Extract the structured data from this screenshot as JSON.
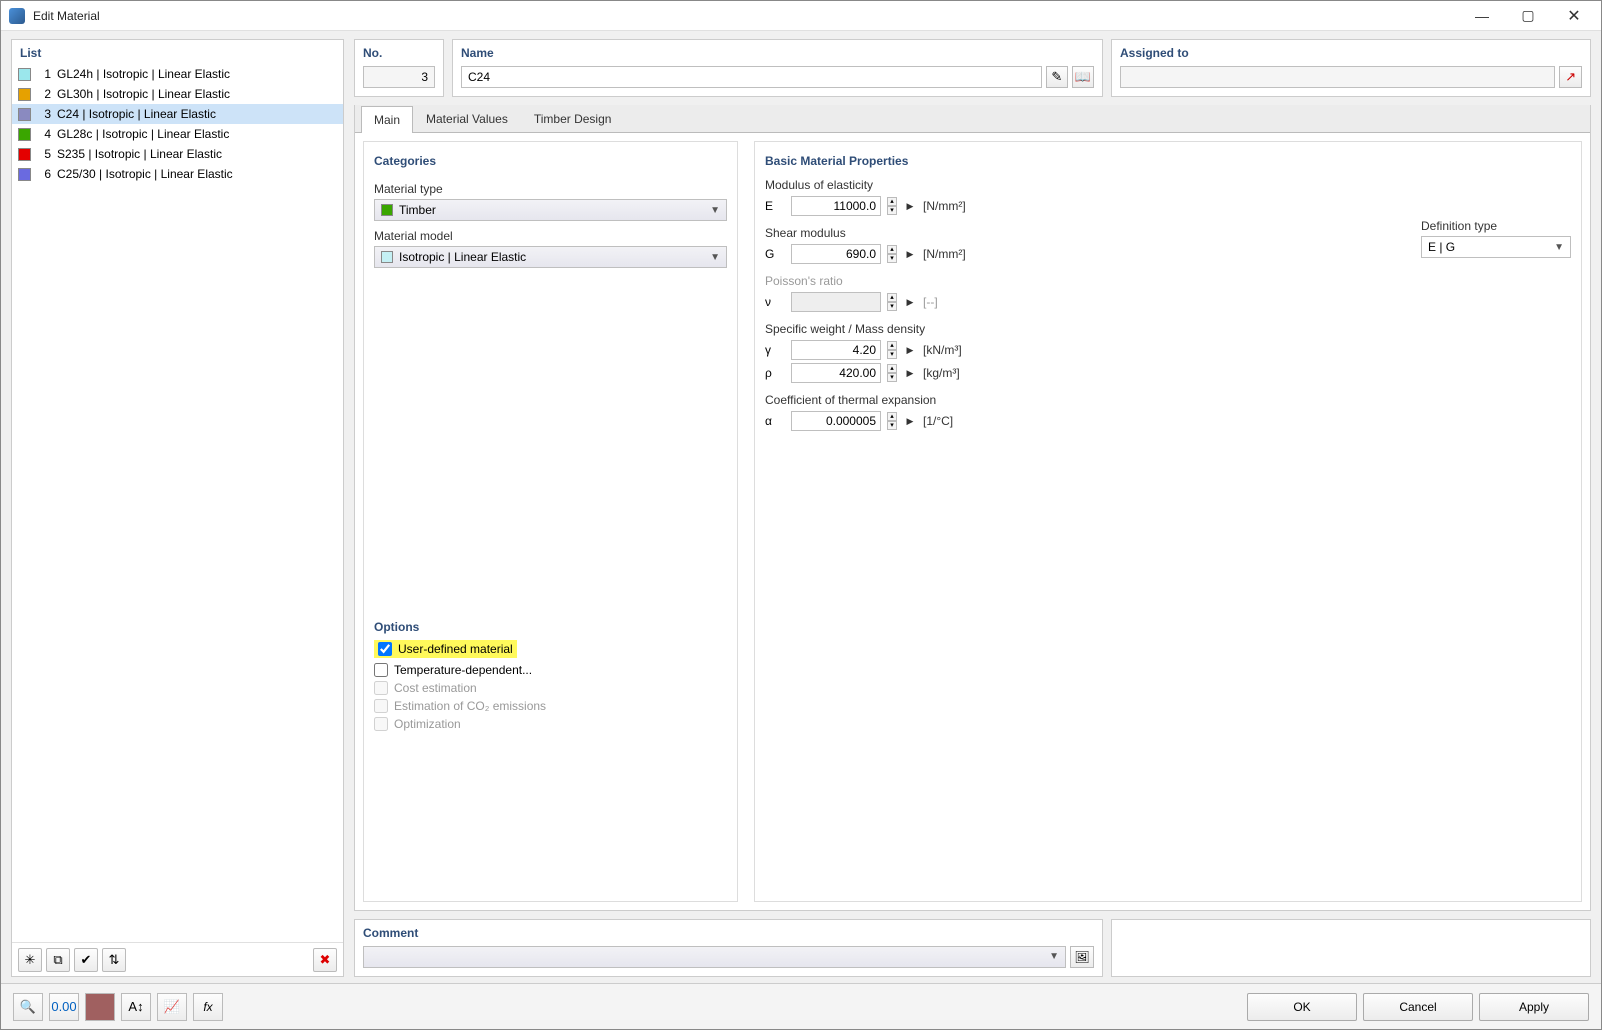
{
  "window": {
    "title": "Edit Material"
  },
  "list": {
    "header": "List",
    "items": [
      {
        "idx": "1",
        "label": "GL24h | Isotropic | Linear Elastic",
        "color": "#9be7ec",
        "selected": false
      },
      {
        "idx": "2",
        "label": "GL30h | Isotropic | Linear Elastic",
        "color": "#e6a100",
        "selected": false
      },
      {
        "idx": "3",
        "label": "C24 | Isotropic | Linear Elastic",
        "color": "#8a8ac0",
        "selected": true
      },
      {
        "idx": "4",
        "label": "GL28c | Isotropic | Linear Elastic",
        "color": "#3aa600",
        "selected": false
      },
      {
        "idx": "5",
        "label": "S235 | Isotropic | Linear Elastic",
        "color": "#e40000",
        "selected": false
      },
      {
        "idx": "6",
        "label": "C25/30 | Isotropic | Linear Elastic",
        "color": "#6a6ae0",
        "selected": false
      }
    ]
  },
  "top": {
    "no_hdr": "No.",
    "no_value": "3",
    "name_hdr": "Name",
    "name_value": "C24",
    "assigned_hdr": "Assigned to",
    "assigned_value": ""
  },
  "tabs": {
    "t0": "Main",
    "t1": "Material Values",
    "t2": "Timber Design"
  },
  "categories": {
    "header": "Categories",
    "type_label": "Material type",
    "type_value": "Timber",
    "type_color": "#3aa600",
    "model_label": "Material model",
    "model_value": "Isotropic | Linear Elastic",
    "model_color": "#c4f0f4"
  },
  "options": {
    "header": "Options",
    "o1": "User-defined material",
    "o2": "Temperature-dependent...",
    "o3": "Cost estimation",
    "o4": "Estimation of CO₂ emissions",
    "o5": "Optimization"
  },
  "props": {
    "header": "Basic Material Properties",
    "mod_e_label": "Modulus of elasticity",
    "E_sym": "E",
    "E_val": "11000.0",
    "E_unit": "[N/mm²]",
    "shear_label": "Shear modulus",
    "G_sym": "G",
    "G_val": "690.0",
    "G_unit": "[N/mm²]",
    "poisson_label": "Poisson's ratio",
    "nu_sym": "ν",
    "nu_val": "",
    "nu_unit": "[--]",
    "weight_label": "Specific weight / Mass density",
    "y_sym": "γ",
    "y_val": "4.20",
    "y_unit": "[kN/m³]",
    "rho_sym": "ρ",
    "rho_val": "420.00",
    "rho_unit": "[kg/m³]",
    "thermal_label": "Coefficient of thermal expansion",
    "a_sym": "α",
    "a_val": "0.000005",
    "a_unit": "[1/°C]",
    "def_type_label": "Definition type",
    "def_type_value": "E | G"
  },
  "comment": {
    "header": "Comment",
    "value": ""
  },
  "buttons": {
    "ok": "OK",
    "cancel": "Cancel",
    "apply": "Apply"
  }
}
